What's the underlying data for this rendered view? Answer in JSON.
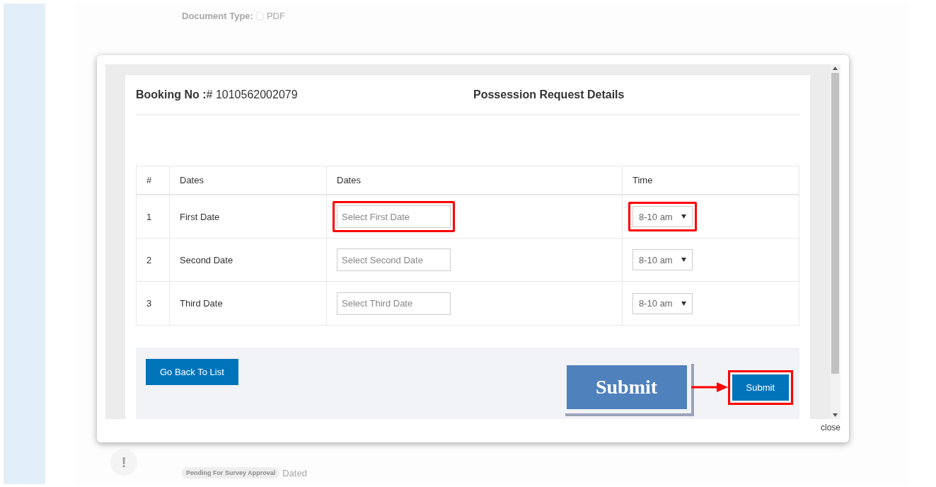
{
  "background": {
    "document_type_label": "Document Type:",
    "document_type_value": "PDF",
    "status_badge": "Pending For Survey Approval",
    "dated_label": "Dated",
    "alert_mark": "!"
  },
  "modal": {
    "booking_label": "Booking No :",
    "booking_number": "# 1010562002079",
    "title": "Possession Request Details",
    "table": {
      "columns": [
        "#",
        "Dates",
        "Dates",
        "Time"
      ],
      "rows": [
        {
          "index": "1",
          "label": "First Date",
          "date_placeholder": "Select First Date",
          "time": "8-10 am",
          "highlighted": true
        },
        {
          "index": "2",
          "label": "Second Date",
          "date_placeholder": "Select Second Date",
          "time": "8-10 am",
          "highlighted": false
        },
        {
          "index": "3",
          "label": "Third Date",
          "date_placeholder": "Select Third Date",
          "time": "8-10 am",
          "highlighted": false
        }
      ]
    },
    "back_button": "Go Back To List",
    "callout": "Submit",
    "submit_button": {
      "label": "Submit",
      "highlighted": true
    },
    "close": "close"
  }
}
